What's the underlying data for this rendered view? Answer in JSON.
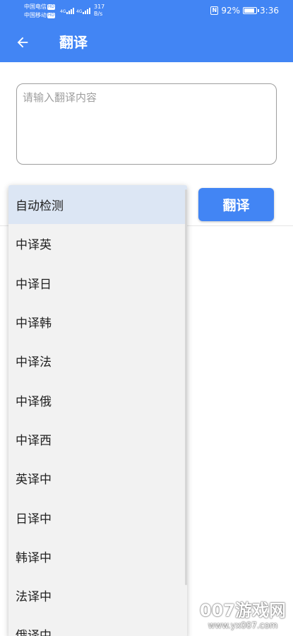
{
  "status_bar": {
    "carrier_1": "中国电信",
    "carrier_2": "中国移动",
    "hd_label": "HD",
    "network_1": "4G",
    "network_2": "4G",
    "speed_value": "317",
    "speed_unit": "B/s",
    "nfc_label": "N",
    "battery_percent": "92%",
    "time": "3:36"
  },
  "app_bar": {
    "back_icon": "arrow-left-icon",
    "title": "翻译"
  },
  "input": {
    "placeholder": "请输入翻译内容",
    "value": ""
  },
  "translate_button": {
    "label": "翻译"
  },
  "language_dropdown": {
    "selected_index": 0,
    "options": [
      "自动检测",
      "中译英",
      "中译日",
      "中译韩",
      "中译法",
      "中译俄",
      "中译西",
      "英译中",
      "日译中",
      "韩译中",
      "法译中",
      "俄译中"
    ]
  },
  "watermark": {
    "name": "007游戏网",
    "url": "www.yx007.com"
  },
  "colors": {
    "primary": "#4285f4",
    "dropdown_bg": "#f2f2f2",
    "selected_bg": "#dce6f4"
  }
}
